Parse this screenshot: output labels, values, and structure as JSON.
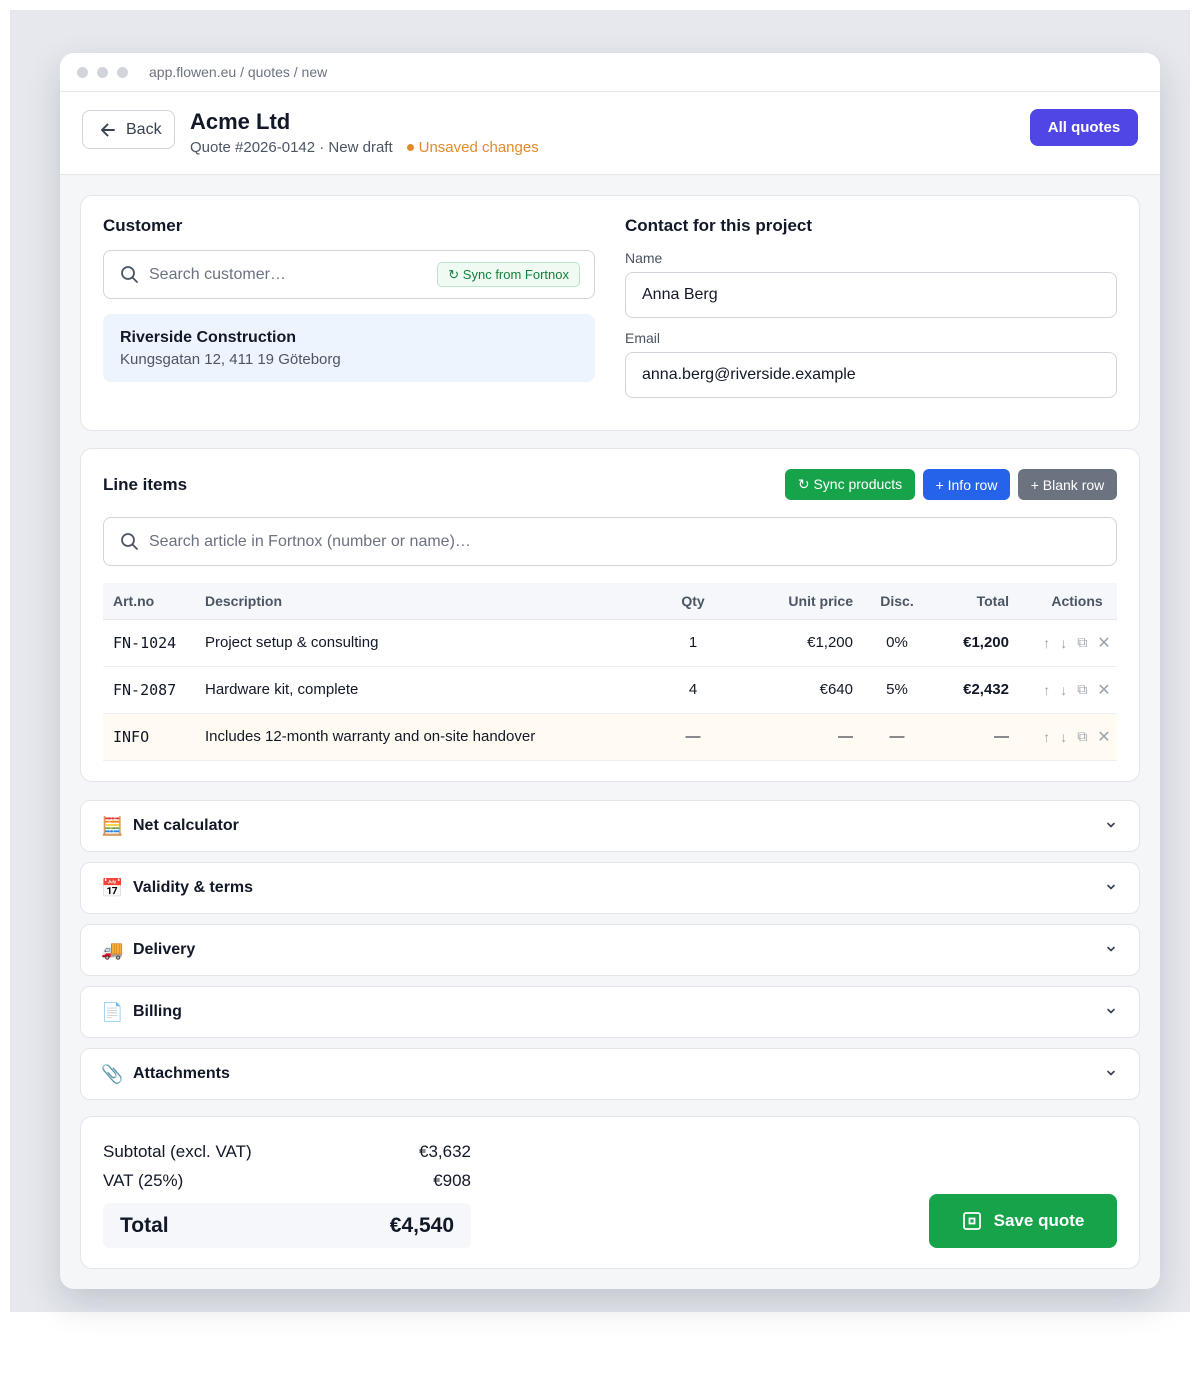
{
  "browser": {
    "url": "app.flowen.eu / quotes / new"
  },
  "header": {
    "back_label": "Back",
    "title": "Acme Ltd",
    "quote_info": "Quote #2026-0142 · New draft",
    "unsaved_label": "Unsaved changes",
    "all_quotes_label": "All quotes"
  },
  "customer": {
    "heading": "Customer",
    "search_placeholder": "Search customer…",
    "sync_label": "↻ Sync from Fortnox",
    "selected_name": "Riverside Construction",
    "selected_address": "Kungsgatan 12, 411 19 Göteborg"
  },
  "contact": {
    "heading": "Contact for this project",
    "name_label": "Name",
    "name_value": "Anna Berg",
    "email_label": "Email",
    "email_value": "anna.berg@riverside.example"
  },
  "line_items": {
    "heading": "Line items",
    "sync_products_label": "↻ Sync products",
    "info_row_label": "+ Info row",
    "blank_row_label": "+ Blank row",
    "search_placeholder": "Search article in Fortnox (number or name)…",
    "columns": {
      "art": "Art.no",
      "desc": "Description",
      "qty": "Qty",
      "unit": "Unit price",
      "disc": "Disc.",
      "total": "Total",
      "actions": "Actions"
    },
    "rows": [
      {
        "art": "FN-1024",
        "desc": "Project setup & consulting",
        "qty": "1",
        "unit": "€1,200",
        "disc": "0%",
        "total": "€1,200"
      },
      {
        "art": "FN-2087",
        "desc": "Hardware kit, complete",
        "qty": "4",
        "unit": "€640",
        "disc": "5%",
        "total": "€2,432"
      },
      {
        "art": "INFO",
        "desc": "Includes 12-month warranty and on-site handover",
        "qty": "—",
        "unit": "—",
        "disc": "—",
        "total": "—"
      }
    ],
    "action_icons": [
      "move-up-icon",
      "move-down-icon",
      "duplicate-icon",
      "delete-icon"
    ]
  },
  "sections": [
    {
      "icon": "🧮",
      "title": "Net calculator"
    },
    {
      "icon": "📅",
      "title": "Validity & terms"
    },
    {
      "icon": "🚚",
      "title": "Delivery"
    },
    {
      "icon": "📄",
      "title": "Billing"
    },
    {
      "icon": "📎",
      "title": "Attachments"
    }
  ],
  "totals": {
    "subtotal_label": "Subtotal (excl. VAT)",
    "subtotal_value": "€3,632",
    "vat_label": "VAT (25%)",
    "vat_value": "€908",
    "total_label": "Total",
    "total_value": "€4,540",
    "save_label": "Save quote"
  },
  "colors": {
    "primary": "#4f46e5",
    "success": "#16a34a",
    "info": "#2563eb",
    "neutral": "#6b7280",
    "warning": "#e08a2c"
  }
}
